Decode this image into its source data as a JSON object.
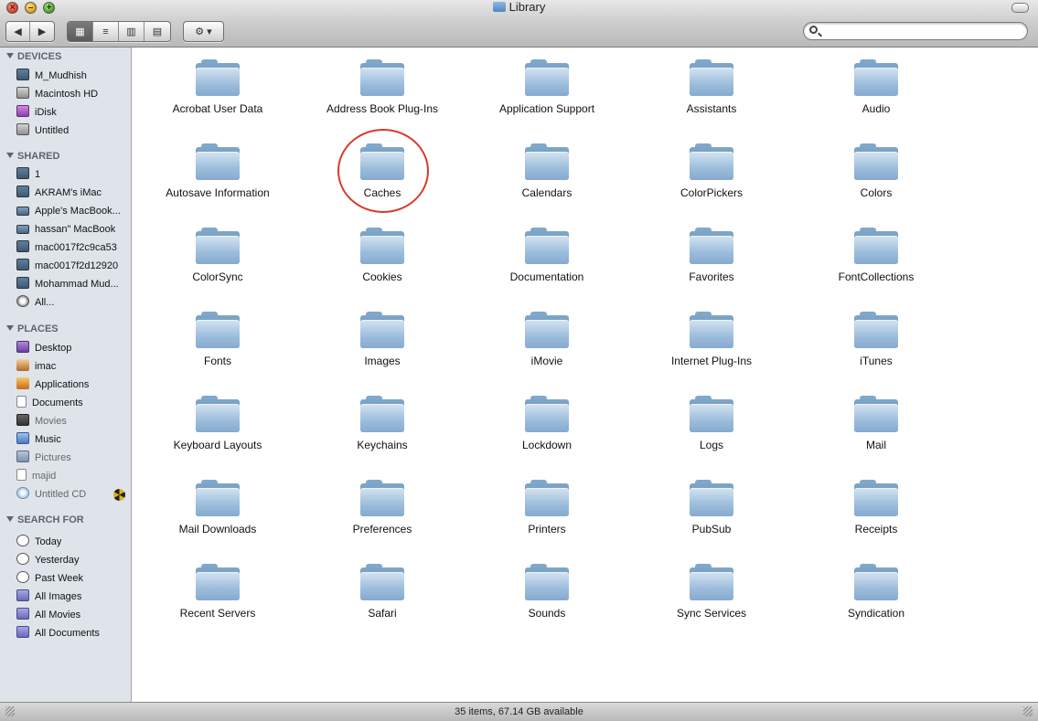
{
  "window": {
    "title": "Library"
  },
  "toolbar": {
    "back": "◀",
    "forward": "▶",
    "view_icons": "▦",
    "view_list": "≡",
    "view_columns": "▥",
    "view_coverflow": "▤",
    "action": "⚙ ▾",
    "search_placeholder": ""
  },
  "sidebar": {
    "devices": {
      "heading": "DEVICES",
      "items": [
        {
          "label": "M_Mudhish",
          "icon": "monitor-icon"
        },
        {
          "label": "Macintosh HD",
          "icon": "hard-disk-icon"
        },
        {
          "label": "iDisk",
          "icon": "idisk-icon"
        },
        {
          "label": "Untitled",
          "icon": "disk-icon"
        }
      ]
    },
    "shared": {
      "heading": "SHARED",
      "items": [
        {
          "label": "1",
          "icon": "monitor-icon"
        },
        {
          "label": "AKRAM's iMac",
          "icon": "monitor-icon"
        },
        {
          "label": "Apple's MacBook...",
          "icon": "laptop-icon"
        },
        {
          "label": "hassan\" MacBook",
          "icon": "laptop-icon"
        },
        {
          "label": "mac0017f2c9ca53",
          "icon": "monitor-icon"
        },
        {
          "label": "mac0017f2d12920",
          "icon": "monitor-icon"
        },
        {
          "label": "Mohammad Mud...",
          "icon": "monitor-icon"
        },
        {
          "label": "All...",
          "icon": "network-icon"
        }
      ]
    },
    "places": {
      "heading": "PLACES",
      "items": [
        {
          "label": "Desktop",
          "icon": "desktop-icon"
        },
        {
          "label": "imac",
          "icon": "home-icon"
        },
        {
          "label": "Applications",
          "icon": "applications-icon"
        },
        {
          "label": "Documents",
          "icon": "documents-icon"
        },
        {
          "label": "Movies",
          "icon": "movies-icon"
        },
        {
          "label": "Music",
          "icon": "music-icon"
        },
        {
          "label": "Pictures",
          "icon": "pictures-icon"
        },
        {
          "label": "majid",
          "icon": "document-icon"
        },
        {
          "label": "Untitled CD",
          "icon": "cd-icon"
        }
      ]
    },
    "search_for": {
      "heading": "SEARCH FOR",
      "items": [
        {
          "label": "Today",
          "icon": "clock-icon"
        },
        {
          "label": "Yesterday",
          "icon": "clock-icon"
        },
        {
          "label": "Past Week",
          "icon": "clock-icon"
        },
        {
          "label": "All Images",
          "icon": "smart-folder-icon"
        },
        {
          "label": "All Movies",
          "icon": "smart-folder-icon"
        },
        {
          "label": "All Documents",
          "icon": "smart-folder-icon"
        }
      ]
    }
  },
  "folders": [
    "Acrobat User Data",
    "Address Book Plug-Ins",
    "Application Support",
    "Assistants",
    "Audio",
    "Autosave Information",
    "Caches",
    "Calendars",
    "ColorPickers",
    "Colors",
    "ColorSync",
    "Cookies",
    "Documentation",
    "Favorites",
    "FontCollections",
    "Fonts",
    "Images",
    "iMovie",
    "Internet Plug-Ins",
    "iTunes",
    "Keyboard Layouts",
    "Keychains",
    "Lockdown",
    "Logs",
    "Mail",
    "Mail Downloads",
    "Preferences",
    "Printers",
    "PubSub",
    "Receipts",
    "Recent Servers",
    "Safari",
    "Sounds",
    "Sync Services",
    "Syndication"
  ],
  "highlighted_folder": "Caches",
  "status": {
    "text": "35 items, 67.14 GB available"
  },
  "colors": {
    "highlight_circle": "#d83a2a",
    "sidebar_bg": "#dfe4ea"
  }
}
